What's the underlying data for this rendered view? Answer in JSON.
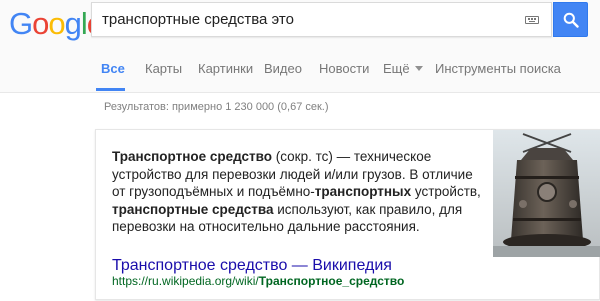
{
  "logo": {
    "text": "Google",
    "colors": [
      "#4285f4",
      "#ea4335",
      "#fbbc05",
      "#4285f4",
      "#34a853",
      "#ea4335"
    ]
  },
  "search": {
    "query": "транспортные средства это"
  },
  "tabs": [
    {
      "label": "Все",
      "active": true
    },
    {
      "label": "Карты"
    },
    {
      "label": "Картинки"
    },
    {
      "label": "Видео"
    },
    {
      "label": "Новости"
    },
    {
      "label": "Ещё"
    },
    {
      "label": "Инструменты поиска"
    }
  ],
  "result_stats": "Результатов: примерно 1 230 000 (0,67 сек.)",
  "answer_card": {
    "snippet": {
      "term": "Транспортное средство",
      "abbr": " (сокр. тс) — техническое устройство для перевозки людей и/или грузов. В отличие от грузоподъёмных и подъёмно-",
      "bold1": "транспортных",
      "mid": " устройств, ",
      "bold2": "транспортные средства",
      "tail": " используют, как правило, для перевозки на относительно дальние расстояния."
    },
    "image_alt": "armored vehicle photo",
    "link_title": "Транспортное средство — Википедия",
    "url_prefix": "https://ru.wikipedia.org/wiki/",
    "url_bold": "Транспортное_средство"
  },
  "colors": {
    "accent": "#4285f4",
    "link": "#1a0dab",
    "url": "#006621",
    "muted": "#777777"
  }
}
